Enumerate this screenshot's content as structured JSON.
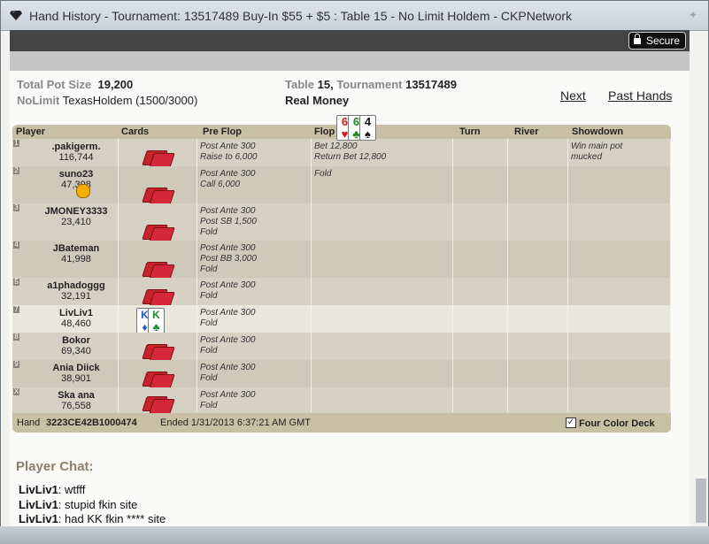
{
  "window": {
    "title": "Hand History - Tournament: 13517489 Buy-In $55 + $5 : Table 15 - No Limit Holdem - CKPNetwork",
    "secure_label": "Secure"
  },
  "summary": {
    "pot_label": "Total Pot Size",
    "pot_value": "19,200",
    "game_type_prefix": "NoLimit",
    "game_type": "TexasHoldem",
    "blinds": "(1500/3000)",
    "table_label": "Table",
    "table_value": "15,",
    "tournament_label": "Tournament",
    "tournament_value": "13517489",
    "money": "Real Money",
    "next": "Next",
    "past_hands": "Past Hands"
  },
  "columns": [
    "Player",
    "Cards",
    "Pre Flop",
    "Flop",
    "Turn",
    "River",
    "Showdown"
  ],
  "flop_cards": [
    {
      "rank": "6",
      "suit": "♥",
      "color": "#d01a1a"
    },
    {
      "rank": "6",
      "suit": "♣",
      "color": "#1a8a2a"
    },
    {
      "rank": "4",
      "suit": "♠",
      "color": "#111111"
    }
  ],
  "players": [
    {
      "seat": "1",
      "name": ".pakigerm.",
      "chips": "116,744",
      "preflop": [
        "Post Ante 300",
        "Raise to 6,000"
      ],
      "flop": [
        "Bet 12,800",
        "Return Bet 12,800"
      ],
      "showdown": [
        "Win main pot",
        "mucked"
      ]
    },
    {
      "seat": "2",
      "name": "suno23",
      "chips": "47,398",
      "preflop": [
        "Post Ante 300",
        "Call 6,000"
      ],
      "flop": [
        "Fold"
      ],
      "showdown": []
    },
    {
      "seat": "3",
      "name": "JMONEY3333",
      "chips": "23,410",
      "preflop": [
        "Post Ante 300",
        "Post SB 1,500",
        "Fold"
      ],
      "flop": [],
      "showdown": []
    },
    {
      "seat": "4",
      "name": "JBateman",
      "chips": "41,998",
      "preflop": [
        "Post Ante 300",
        "Post BB 3,000",
        "Fold"
      ],
      "flop": [],
      "showdown": []
    },
    {
      "seat": "5",
      "name": "a1phadoggg",
      "chips": "32,191",
      "preflop": [
        "Post Ante 300",
        "Fold"
      ],
      "flop": [],
      "showdown": []
    },
    {
      "seat": "7",
      "name": "LivLiv1",
      "chips": "48,460",
      "preflop": [
        "Post Ante 300",
        "Fold"
      ],
      "flop": [],
      "showdown": []
    },
    {
      "seat": "8",
      "name": "Bokor",
      "chips": "69,340",
      "preflop": [
        "Post Ante 300",
        "Fold"
      ],
      "flop": [],
      "showdown": []
    },
    {
      "seat": "9",
      "name": "Ania Diick",
      "chips": "38,901",
      "preflop": [
        "Post Ante 300",
        "Fold"
      ],
      "flop": [],
      "showdown": []
    },
    {
      "seat": "X",
      "name": "Ska ana",
      "chips": "76,558",
      "preflop": [
        "Post Ante 300",
        "Fold"
      ],
      "flop": [],
      "showdown": []
    }
  ],
  "hero_cards": [
    {
      "rank": "K",
      "suit": "♦",
      "color": "#1a5bd0"
    },
    {
      "rank": "K",
      "suit": "♣",
      "color": "#1a8a2a"
    }
  ],
  "footer": {
    "hand_label": "Hand",
    "hand_id": "3223CE42B1000474",
    "ended": "Ended 1/31/2013 6:37:21 AM GMT",
    "four_color": "Four Color Deck"
  },
  "chat": {
    "title": "Player Chat:",
    "lines": [
      {
        "user": "LivLiv1",
        "text": "wtfff"
      },
      {
        "user": "LivLiv1",
        "text": "stupid fkin site"
      },
      {
        "user": "LivLiv1",
        "text": "had KK fkin **** site"
      }
    ]
  }
}
